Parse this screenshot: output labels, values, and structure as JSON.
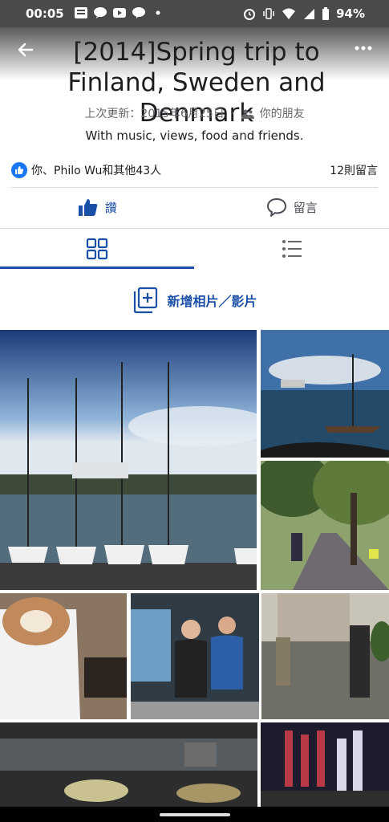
{
  "status_bar": {
    "time": "00:05",
    "battery": "94%",
    "notification_icons": [
      "news-icon",
      "talk-icon",
      "youtube-icon",
      "line-icon",
      "dot-icon"
    ],
    "system_icons": [
      "alarm-icon",
      "vibrate-icon",
      "wifi-icon",
      "signal-icon",
      "battery-icon"
    ]
  },
  "album": {
    "title": "[2014]Spring trip to Finland, Sweden and Denmark",
    "updated": "上次更新：2015年6月25日",
    "audience": "你的朋友",
    "description": "With music, views, food and friends."
  },
  "reactions": {
    "likers": "你、Philo Wu和其他43人",
    "comment_count": "12則留言"
  },
  "actions": {
    "like_label": "讚",
    "comment_label": "留言"
  },
  "add_media_label": "新增相片／影片",
  "colors": {
    "accent": "#1877f2",
    "action_blue": "#1a4fa8",
    "status_bar": "#4a4a4a"
  }
}
